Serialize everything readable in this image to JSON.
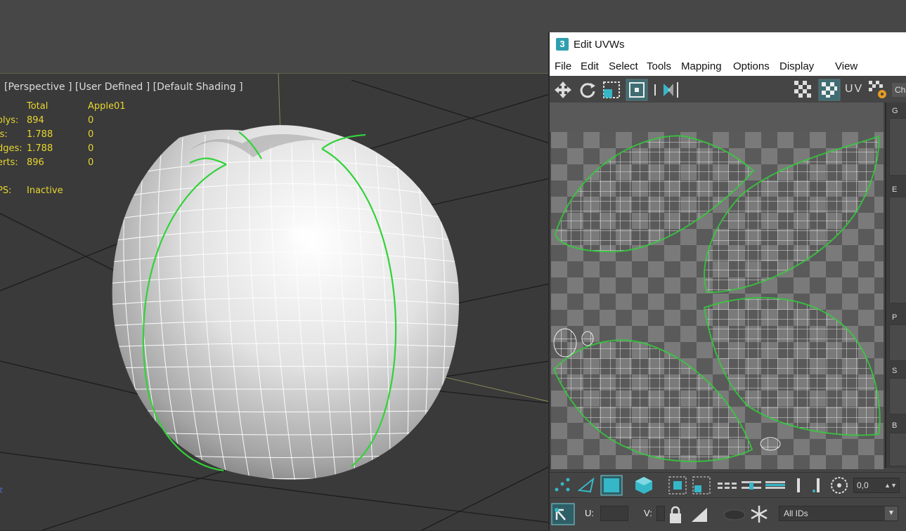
{
  "viewport": {
    "label": "[Perspective ] [User Defined ] [Default Shading ]",
    "stats": {
      "header_total": "Total",
      "header_object": "Apple01",
      "rows": [
        {
          "name": "olys:",
          "total": "894",
          "object": "0"
        },
        {
          "name": "is:",
          "total": "1.788",
          "object": "0"
        },
        {
          "name": "dges:",
          "total": "1.788",
          "object": "0"
        },
        {
          "name": "erts:",
          "total": "896",
          "object": "0"
        }
      ],
      "fps_label": "PS:",
      "fps_value": "Inactive"
    },
    "axis_label": "z"
  },
  "uvw_window": {
    "title": "Edit UVWs",
    "logo": "3",
    "menu": [
      "File",
      "Edit",
      "Select",
      "Tools",
      "Mapping",
      "Options",
      "Display",
      "View"
    ],
    "toolbar": {
      "uv_label": "UV",
      "checker_button": "Ch"
    },
    "right_sections": [
      "G",
      "E",
      "P",
      "S",
      "B"
    ],
    "bottom": {
      "value_field": "0,0",
      "u_label": "U:",
      "v_label": "V:",
      "ids_dropdown": "All IDs"
    }
  },
  "colors": {
    "seam_green": "#32d23a",
    "accent_teal": "#36b7c8",
    "stats_yellow": "#e7d62f"
  }
}
